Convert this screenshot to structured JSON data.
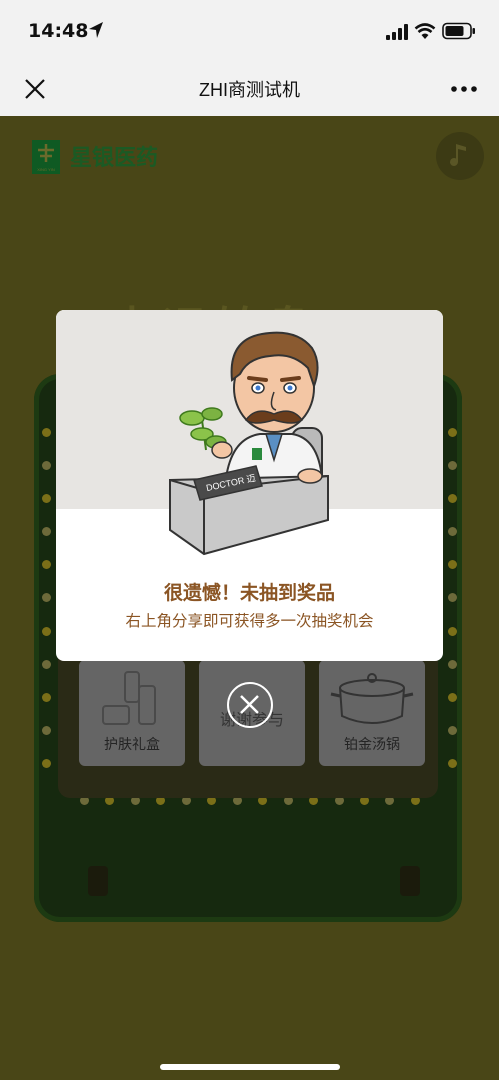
{
  "status_bar": {
    "time": "14:48"
  },
  "nav": {
    "title": "ZHI商测试机"
  },
  "brand": {
    "logo_text": "XING YIN",
    "name": "星银医药"
  },
  "background": {
    "title_partial": "幸运转盘"
  },
  "prizes": [
    {
      "label": "护肤礼盒",
      "icon": "skincare-bottles-icon"
    },
    {
      "label": "谢谢参与",
      "icon": "none"
    },
    {
      "label": "铂金汤锅",
      "icon": "cooking-pot-icon"
    }
  ],
  "modal": {
    "badge_text": "DOCTOR 迈",
    "title": "很遗憾！未抽到奖品",
    "subtitle": "右上角分享即可获得多一次抽奖机会"
  },
  "colors": {
    "modal_text": "#8b5524",
    "page_bg": "#494617",
    "brand_green": "#1b5a24"
  }
}
